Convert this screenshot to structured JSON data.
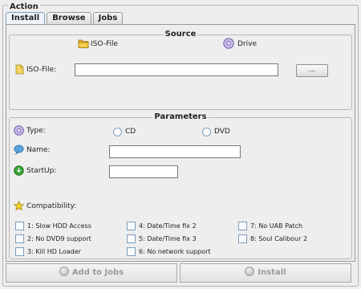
{
  "frame": {
    "title": "Action"
  },
  "tabs": [
    {
      "label": "Install",
      "active": true
    },
    {
      "label": "Browse",
      "active": false
    },
    {
      "label": "Jobs",
      "active": false
    }
  ],
  "source": {
    "title": "Source",
    "options": [
      {
        "label": "ISO-File",
        "icon": "folder-icon"
      },
      {
        "label": "Drive",
        "icon": "disc-icon"
      }
    ],
    "iso_label": "ISO-File:",
    "iso_value": "",
    "browse_label": "..."
  },
  "parameters": {
    "title": "Parameters",
    "type_label": "Type:",
    "type_options": [
      "CD",
      "DVD"
    ],
    "name_label": "Name:",
    "name_value": "",
    "startup_label": "StartUp:",
    "startup_value": "",
    "compat_label": "Compatibility:",
    "compat_options": [
      "1: Slow HDD Access",
      "2: No DVD9 support",
      "3: Kill HD Loader",
      "4: Date/Time fix 2",
      "5: Date/Time fix 3",
      "6: No network support",
      "7: No UAB Patch",
      "8: Soul Calibour 2"
    ]
  },
  "actions": {
    "add_label": "Add to Jobs",
    "install_label": "Install",
    "enabled": false
  },
  "colors": {
    "background": "#eeeeee",
    "tab_active": "#eef3fa",
    "disabled_text": "#9a9a9a"
  }
}
